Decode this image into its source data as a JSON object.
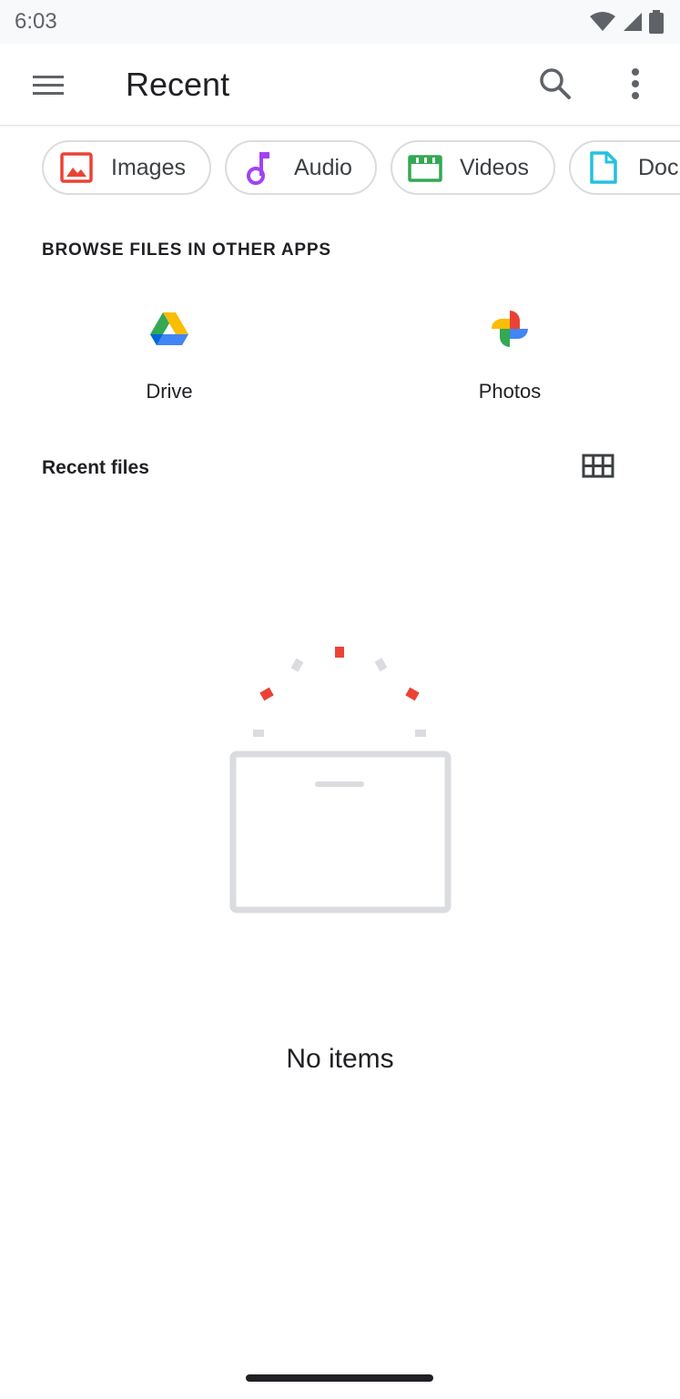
{
  "status_bar": {
    "time": "6:03"
  },
  "app_bar": {
    "title": "Recent"
  },
  "chips": [
    {
      "label": "Images",
      "icon": "image-icon",
      "color": "#ea4335"
    },
    {
      "label": "Audio",
      "icon": "music-note-icon",
      "color": "#a142f4"
    },
    {
      "label": "Videos",
      "icon": "movie-icon",
      "color": "#34a853"
    },
    {
      "label": "Doc",
      "icon": "document-icon",
      "color": "#24c1e0"
    }
  ],
  "browse_section": {
    "title": "BROWSE FILES IN OTHER APPS",
    "apps": [
      {
        "label": "Drive",
        "icon": "google-drive-icon"
      },
      {
        "label": "Photos",
        "icon": "google-photos-icon"
      }
    ]
  },
  "recent_files": {
    "title": "Recent files",
    "view_toggle_icon": "grid-view-icon"
  },
  "empty_state": {
    "message": "No items"
  },
  "colors": {
    "red": "#ea4335",
    "gray": "#dadce0",
    "text": "#202124"
  }
}
